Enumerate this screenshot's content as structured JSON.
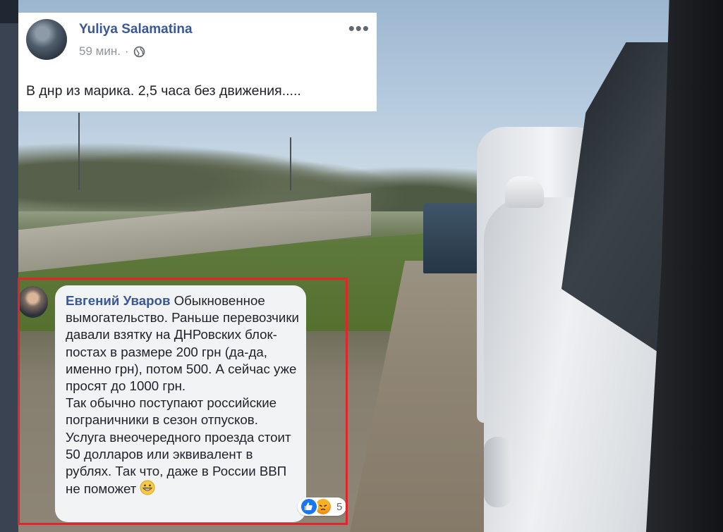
{
  "post": {
    "author": "Yuliya Salamatina",
    "time": "59 мин.",
    "separator": "·",
    "text": "В днр из марика. 2,5 часа без движения....."
  },
  "comment": {
    "author": "Евгений Уваров",
    "text_first": " Обыкновенное вымогательство. Раньше перевозчики давали взятку на ДНРовских блок-постах в размере 200 грн (да-да, именно грн), потом 500. А сейчас уже просят до 1000 грн.",
    "text_second": "Так обычно поступают российские пограничники в сезон отпусков. Услуга внеочередного проезда стоит 50 долларов или эквивалент в рублях. Так что, даже в России ВВП не поможет",
    "reaction_count": "5"
  },
  "colors": {
    "link": "#385898",
    "highlight_border": "#e3242b",
    "bubble": "#f2f3f5"
  },
  "icons": [
    "globe-icon",
    "more-options-icon",
    "grinning-emoji-icon",
    "like-reaction-icon",
    "angry-reaction-icon"
  ]
}
